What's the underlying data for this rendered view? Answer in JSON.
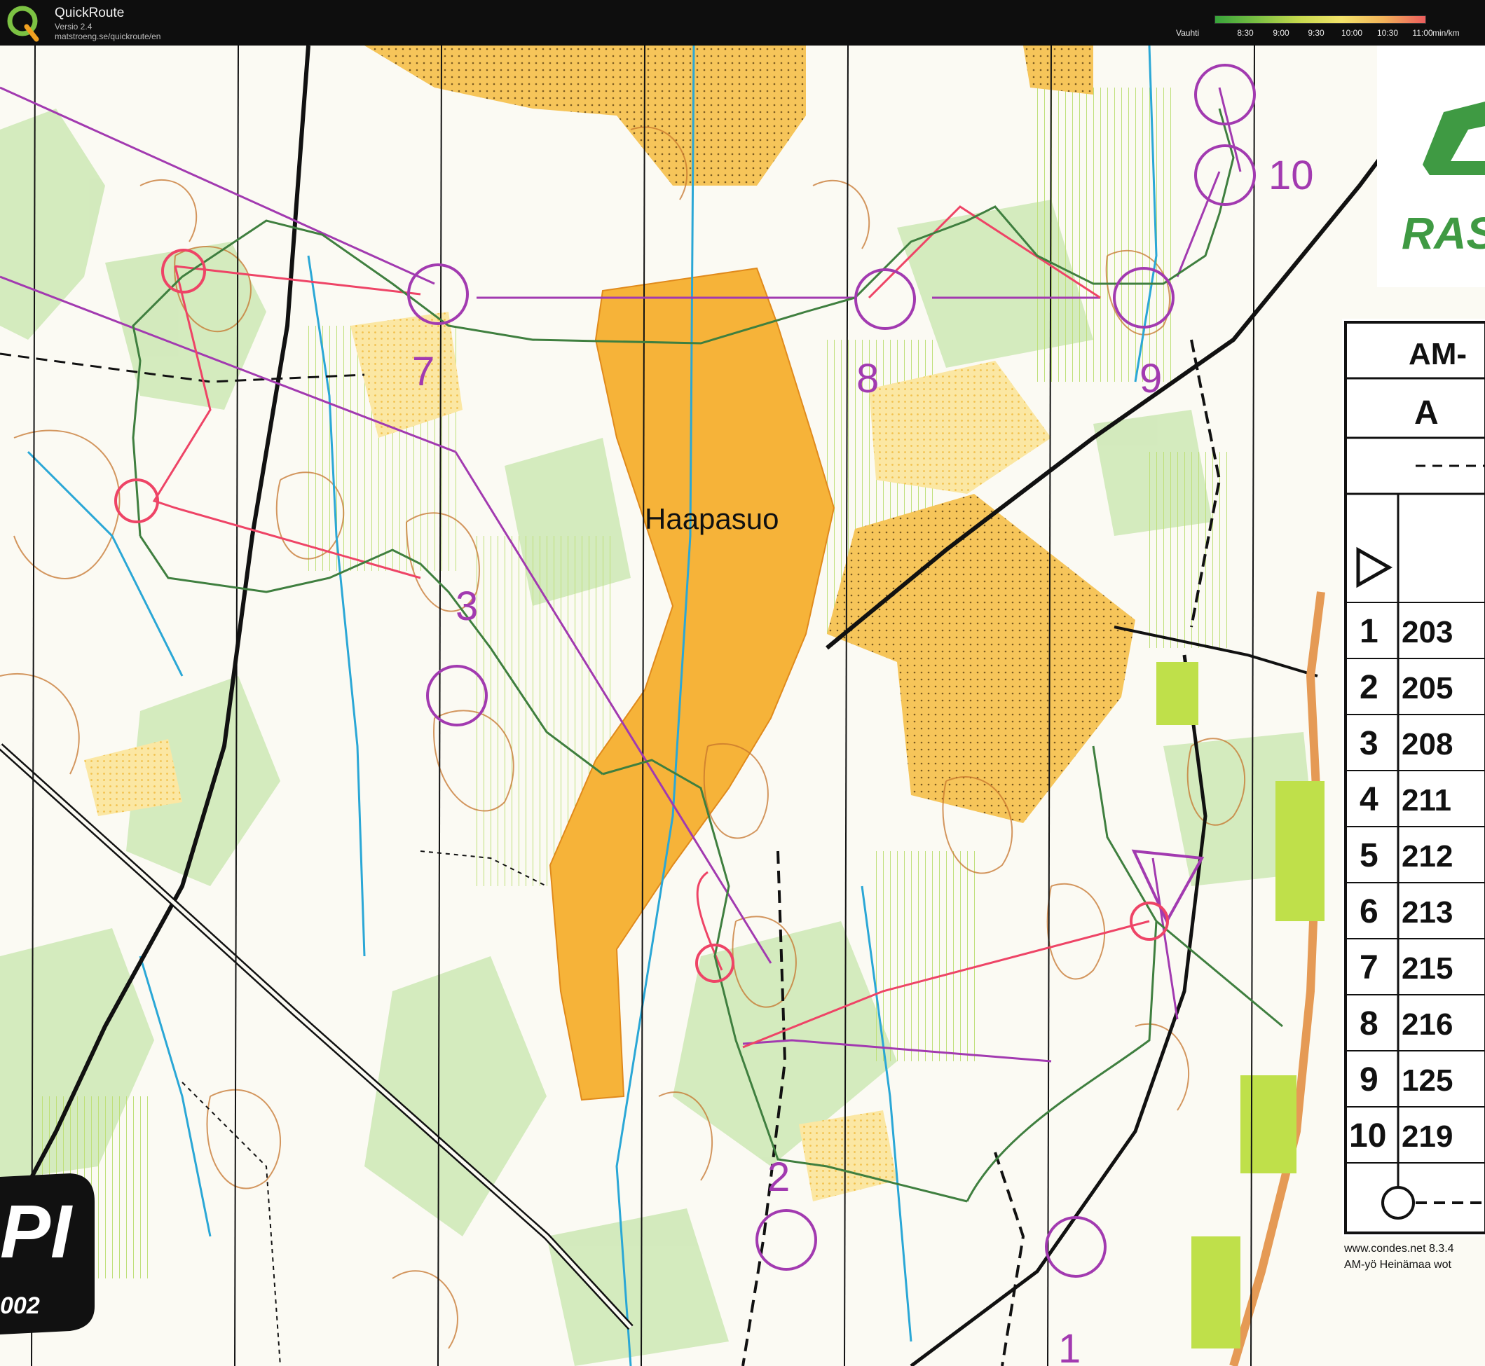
{
  "app": {
    "title": "QuickRoute",
    "version": "Versio 2.4",
    "url": "matstroeng.se/quickroute/en"
  },
  "pace_scale": {
    "label": "Vauhti",
    "ticks": [
      "8:30",
      "9:00",
      "9:30",
      "10:00",
      "10:30",
      "11:00"
    ],
    "unit": "min/km",
    "colors": [
      "#37a33a",
      "#c6d94d",
      "#f3e36a",
      "#ec5d5d"
    ]
  },
  "map": {
    "place_name": "Haapasuo",
    "course_color": "#a23ab0",
    "route_color": "#3f7f3f",
    "controls": [
      {
        "label": "1"
      },
      {
        "label": "2"
      },
      {
        "label": "3"
      },
      {
        "label": "7"
      },
      {
        "label": "8"
      },
      {
        "label": "9"
      },
      {
        "label": "10"
      }
    ],
    "sponsor_text": "RAS",
    "logo_text": "PI",
    "logo_number": "002"
  },
  "control_card": {
    "header_code": "AM-",
    "class": "A",
    "rows": [
      {
        "num": "1",
        "code": "203"
      },
      {
        "num": "2",
        "code": "205"
      },
      {
        "num": "3",
        "code": "208"
      },
      {
        "num": "4",
        "code": "211"
      },
      {
        "num": "5",
        "code": "212"
      },
      {
        "num": "6",
        "code": "213"
      },
      {
        "num": "7",
        "code": "215"
      },
      {
        "num": "8",
        "code": "216"
      },
      {
        "num": "9",
        "code": "125"
      },
      {
        "num": "10",
        "code": "219"
      }
    ],
    "footer_url": "www.condes.net 8.3.4",
    "footer_event": "AM-yö Heinämaa wot"
  }
}
